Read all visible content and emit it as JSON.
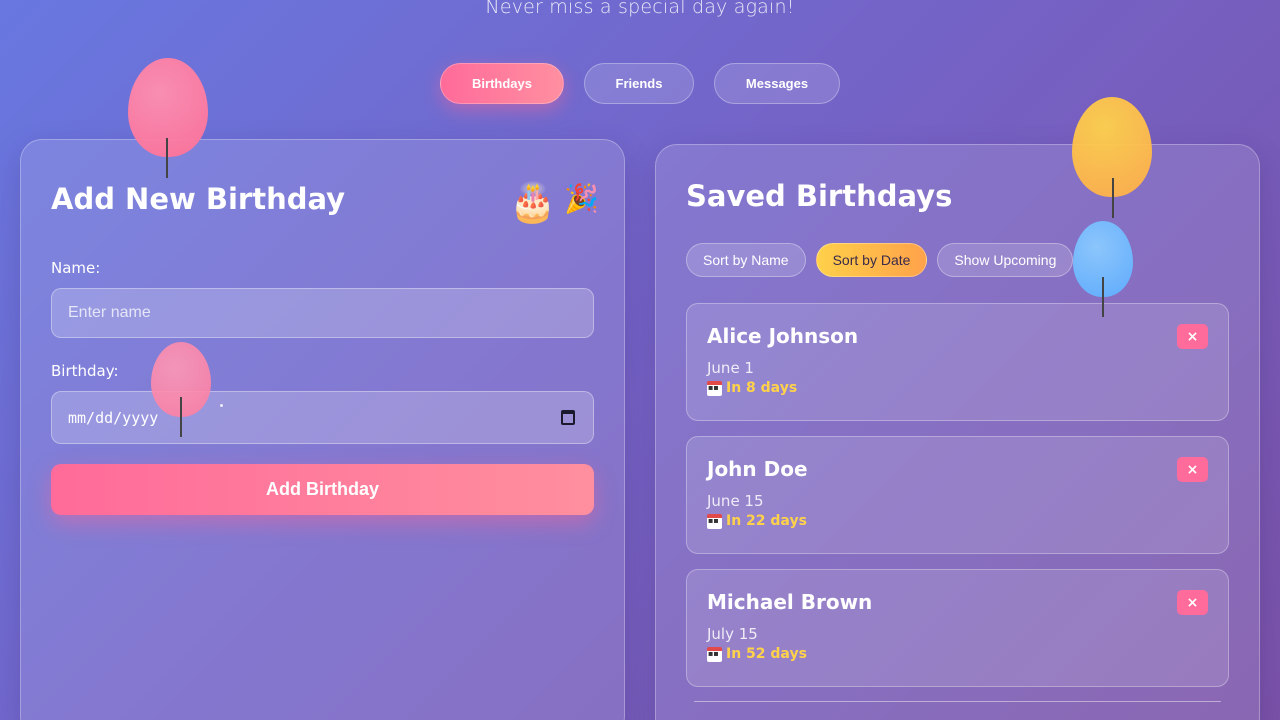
{
  "header": {
    "tagline": "Never miss a special day again!"
  },
  "nav": {
    "tabs": [
      {
        "label": "Birthdays",
        "active": true
      },
      {
        "label": "Friends",
        "active": false
      },
      {
        "label": "Messages",
        "active": false
      }
    ]
  },
  "add_panel": {
    "title": "Add New Birthday",
    "decor_icons": [
      "birthday-cake-icon",
      "party-popper-icon"
    ],
    "name_label": "Name:",
    "name_placeholder": "Enter name",
    "name_value": "",
    "birthday_label": "Birthday:",
    "birthday_value": "mm/dd/yyyy",
    "submit_label": "Add Birthday"
  },
  "saved_panel": {
    "title": "Saved Birthdays",
    "sort_buttons": [
      {
        "label": "Sort by Name",
        "active": false
      },
      {
        "label": "Sort by Date",
        "active": true
      },
      {
        "label": "Show Upcoming",
        "active": false
      }
    ],
    "birthdays": [
      {
        "name": "Alice Johnson",
        "date": "June 1",
        "countdown": "In 8 days"
      },
      {
        "name": "John Doe",
        "date": "June 15",
        "countdown": "In 22 days"
      },
      {
        "name": "Michael Brown",
        "date": "July 15",
        "countdown": "In 52 days"
      }
    ],
    "delete_label": "×"
  },
  "colors": {
    "accent_pink": "#ff6b9a",
    "accent_yellow": "#ffd24a",
    "balloon_pink": "#ff7a9c",
    "balloon_orange": "#ffb347",
    "balloon_blue": "#6ab8ff"
  }
}
